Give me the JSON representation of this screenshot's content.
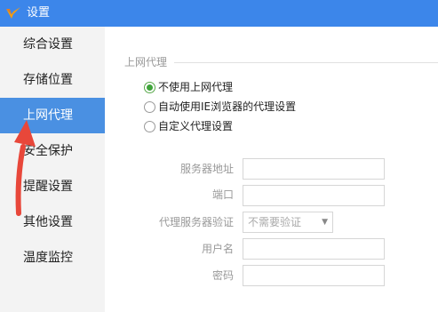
{
  "window": {
    "title": "设置",
    "logo_icon": "app-logo-icon",
    "accent_color": "#3c86ea"
  },
  "sidebar": {
    "items": [
      {
        "label": "综合设置",
        "active": false
      },
      {
        "label": "存储位置",
        "active": false
      },
      {
        "label": "上网代理",
        "active": true
      },
      {
        "label": "安全保护",
        "active": false
      },
      {
        "label": "提醒设置",
        "active": false
      },
      {
        "label": "其他设置",
        "active": false
      },
      {
        "label": "温度监控",
        "active": false
      }
    ],
    "active_color": "#4a90e2"
  },
  "proxy": {
    "group_label": "上网代理",
    "options": [
      {
        "label": "不使用上网代理",
        "checked": true
      },
      {
        "label": "自动使用IE浏览器的代理设置",
        "checked": false
      },
      {
        "label": "自定义代理设置",
        "checked": false
      }
    ],
    "fields": {
      "server_address": {
        "label": "服务器地址",
        "value": ""
      },
      "port": {
        "label": "端口",
        "value": ""
      },
      "auth": {
        "label": "代理服务器验证",
        "selected": "不需要验证",
        "dropdown_icon": "triangle-down-icon"
      },
      "username": {
        "label": "用户名",
        "value": ""
      },
      "password": {
        "label": "密码",
        "value": ""
      }
    }
  },
  "annotation": {
    "arrow_color": "#e8473a",
    "icon": "red-arrow-icon"
  }
}
